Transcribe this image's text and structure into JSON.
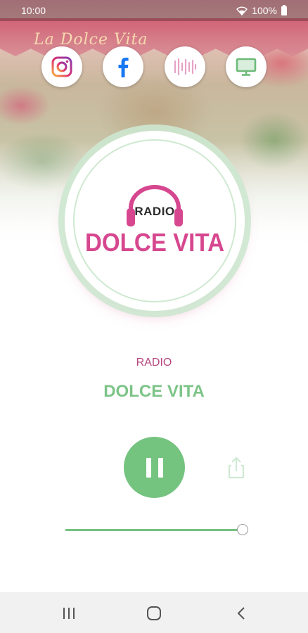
{
  "status_bar": {
    "time": "10:00",
    "battery": "100%",
    "icons": [
      "wifi-icon",
      "battery-icon"
    ]
  },
  "header": {
    "awning_text": "La Dolce Vita"
  },
  "social_links": [
    {
      "name": "instagram",
      "icon": "instagram-icon"
    },
    {
      "name": "facebook",
      "icon": "facebook-icon"
    },
    {
      "name": "station-app",
      "icon": "waveform-icon"
    },
    {
      "name": "website",
      "icon": "monitor-icon"
    }
  ],
  "logo": {
    "top_text": "RADIO",
    "main_text": "DOLCE VITA"
  },
  "now_playing": {
    "line1": "RADIO",
    "line2": "DOLCE VITA"
  },
  "player": {
    "state": "playing",
    "volume": 1.0
  },
  "colors": {
    "accent_green": "#74c37f",
    "brand_pink": "#d6478f",
    "subtitle_pink": "#b6477f"
  },
  "navigation": {
    "buttons": [
      "recent-apps",
      "home",
      "back"
    ]
  }
}
